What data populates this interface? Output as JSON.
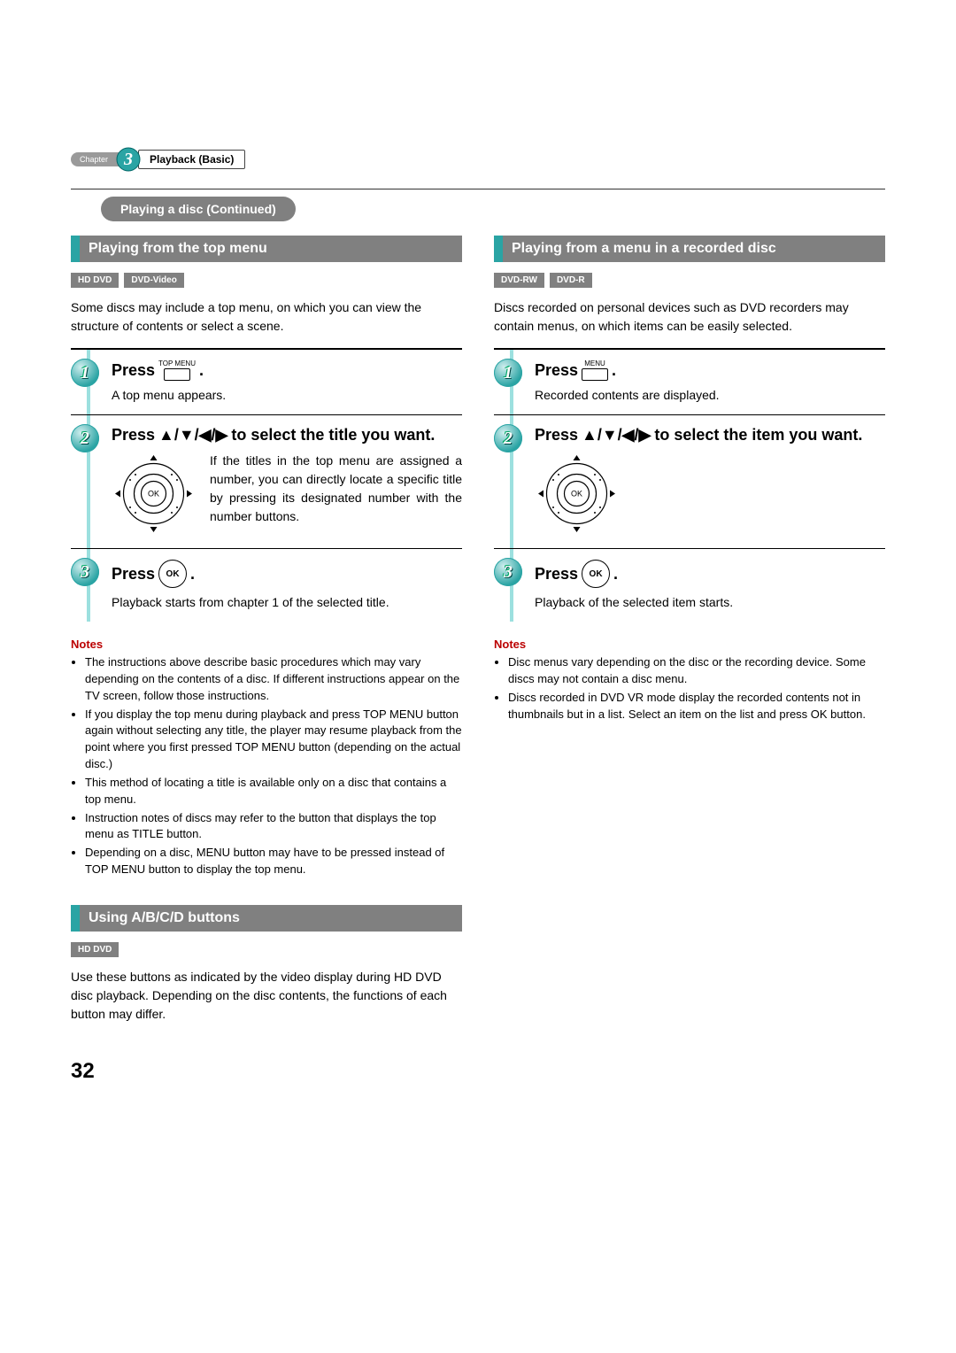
{
  "chapter": {
    "label": "Chapter",
    "number": "3",
    "title": "Playback (Basic)"
  },
  "tab": "Playing a disc (Continued)",
  "left": {
    "sec1": {
      "title": "Playing from the top menu",
      "badges": [
        "HD DVD",
        "DVD-Video"
      ],
      "intro": "Some discs may include a top menu, on which you can view the structure of contents or select a scene.",
      "step1": {
        "press": "Press",
        "key_label": "TOP MENU",
        "dot": ".",
        "sub": "A top menu appears."
      },
      "step2": {
        "press": "Press",
        "arrows": "▲/▼/◀/▶",
        "tail": "to select the title you want.",
        "ok": "OK",
        "side": "If the titles in the top menu are assigned a number, you can directly locate a specific title by pressing its designated number with the number buttons."
      },
      "step3": {
        "press": "Press",
        "ok": "OK",
        "dot": ".",
        "sub": "Playback starts from chapter 1 of the selected title."
      },
      "notes_hdr": "Notes",
      "notes": [
        "The instructions above describe basic procedures which may vary depending on the contents of a disc. If different instructions appear on the TV screen, follow those instructions.",
        "If you display the top menu during playback and press TOP MENU button again without selecting any title, the player may resume playback from the point where you first pressed TOP MENU button (depending on the actual disc.)",
        "This method of locating a title is available only on a disc that contains a top menu.",
        "Instruction notes of discs may refer to the button that displays the top menu as TITLE button.",
        "Depending on a disc, MENU button may have to be pressed instead of TOP MENU button to display the top menu."
      ]
    },
    "sec2": {
      "title": "Using A/B/C/D buttons",
      "badges": [
        "HD DVD"
      ],
      "intro": "Use these buttons as indicated by the video display during HD DVD disc playback. Depending on the disc contents, the functions of each button may differ."
    }
  },
  "right": {
    "sec1": {
      "title": "Playing from a menu in a recorded disc",
      "badges": [
        "DVD-RW",
        "DVD-R"
      ],
      "intro": "Discs recorded on personal devices such as DVD recorders may contain menus, on which items can be easily selected.",
      "step1": {
        "press": "Press",
        "key_label": "MENU",
        "dot": ".",
        "sub": "Recorded contents are displayed."
      },
      "step2": {
        "press": "Press",
        "arrows": "▲/▼/◀/▶",
        "tail": "to select the item you want.",
        "ok": "OK"
      },
      "step3": {
        "press": "Press",
        "ok": "OK",
        "dot": ".",
        "sub": "Playback of the selected item starts."
      },
      "notes_hdr": "Notes",
      "notes": [
        "Disc menus vary depending on the disc or the recording device. Some discs may not contain a disc menu.",
        "Discs recorded in DVD VR mode display the recorded contents not in thumbnails but in a list. Select an item on the list and press OK button."
      ]
    }
  },
  "page_number": "32"
}
